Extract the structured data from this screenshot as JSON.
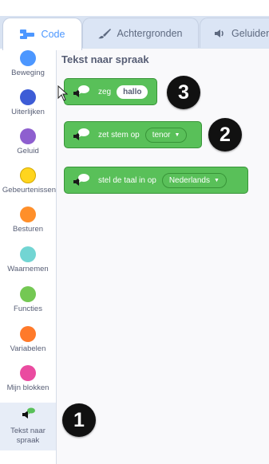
{
  "tabs": [
    {
      "label": "Code",
      "icon": "code-icon",
      "active": true
    },
    {
      "label": "Achtergronden",
      "icon": "paintbrush-icon",
      "active": false
    },
    {
      "label": "Geluiden",
      "icon": "speaker-icon",
      "active": false
    }
  ],
  "categories": [
    {
      "label": "Beweging",
      "color": "#4c97ff"
    },
    {
      "label": "Uiterlijken",
      "color": "#3d5cd6"
    },
    {
      "label": "Geluid",
      "color": "#8e5fcf"
    },
    {
      "label": "Gebeurtenissen",
      "color": "#ffd51e"
    },
    {
      "label": "Besturen",
      "color": "#ff8f2a"
    },
    {
      "label": "Waarnemen",
      "color": "#72d5d3"
    },
    {
      "label": "Functies",
      "color": "#74c853"
    },
    {
      "label": "Variabelen",
      "color": "#ff7a2a"
    },
    {
      "label": "Mijn blokken",
      "color": "#ea4ba0"
    },
    {
      "label": "Tekst naar spraak",
      "color": "#59c059",
      "selected": true
    }
  ],
  "palette": {
    "title": "Tekst naar spraak",
    "blocks": [
      {
        "text": "zeg",
        "input": "hallo"
      },
      {
        "text": "zet stem op",
        "dropdown": "tenor"
      },
      {
        "text": "stel de taal in op",
        "dropdown": "Nederlands"
      }
    ]
  },
  "badges": [
    "3",
    "2",
    "1"
  ],
  "colors": {
    "accent": "#4c97ff",
    "extension_green": "#59c059"
  }
}
